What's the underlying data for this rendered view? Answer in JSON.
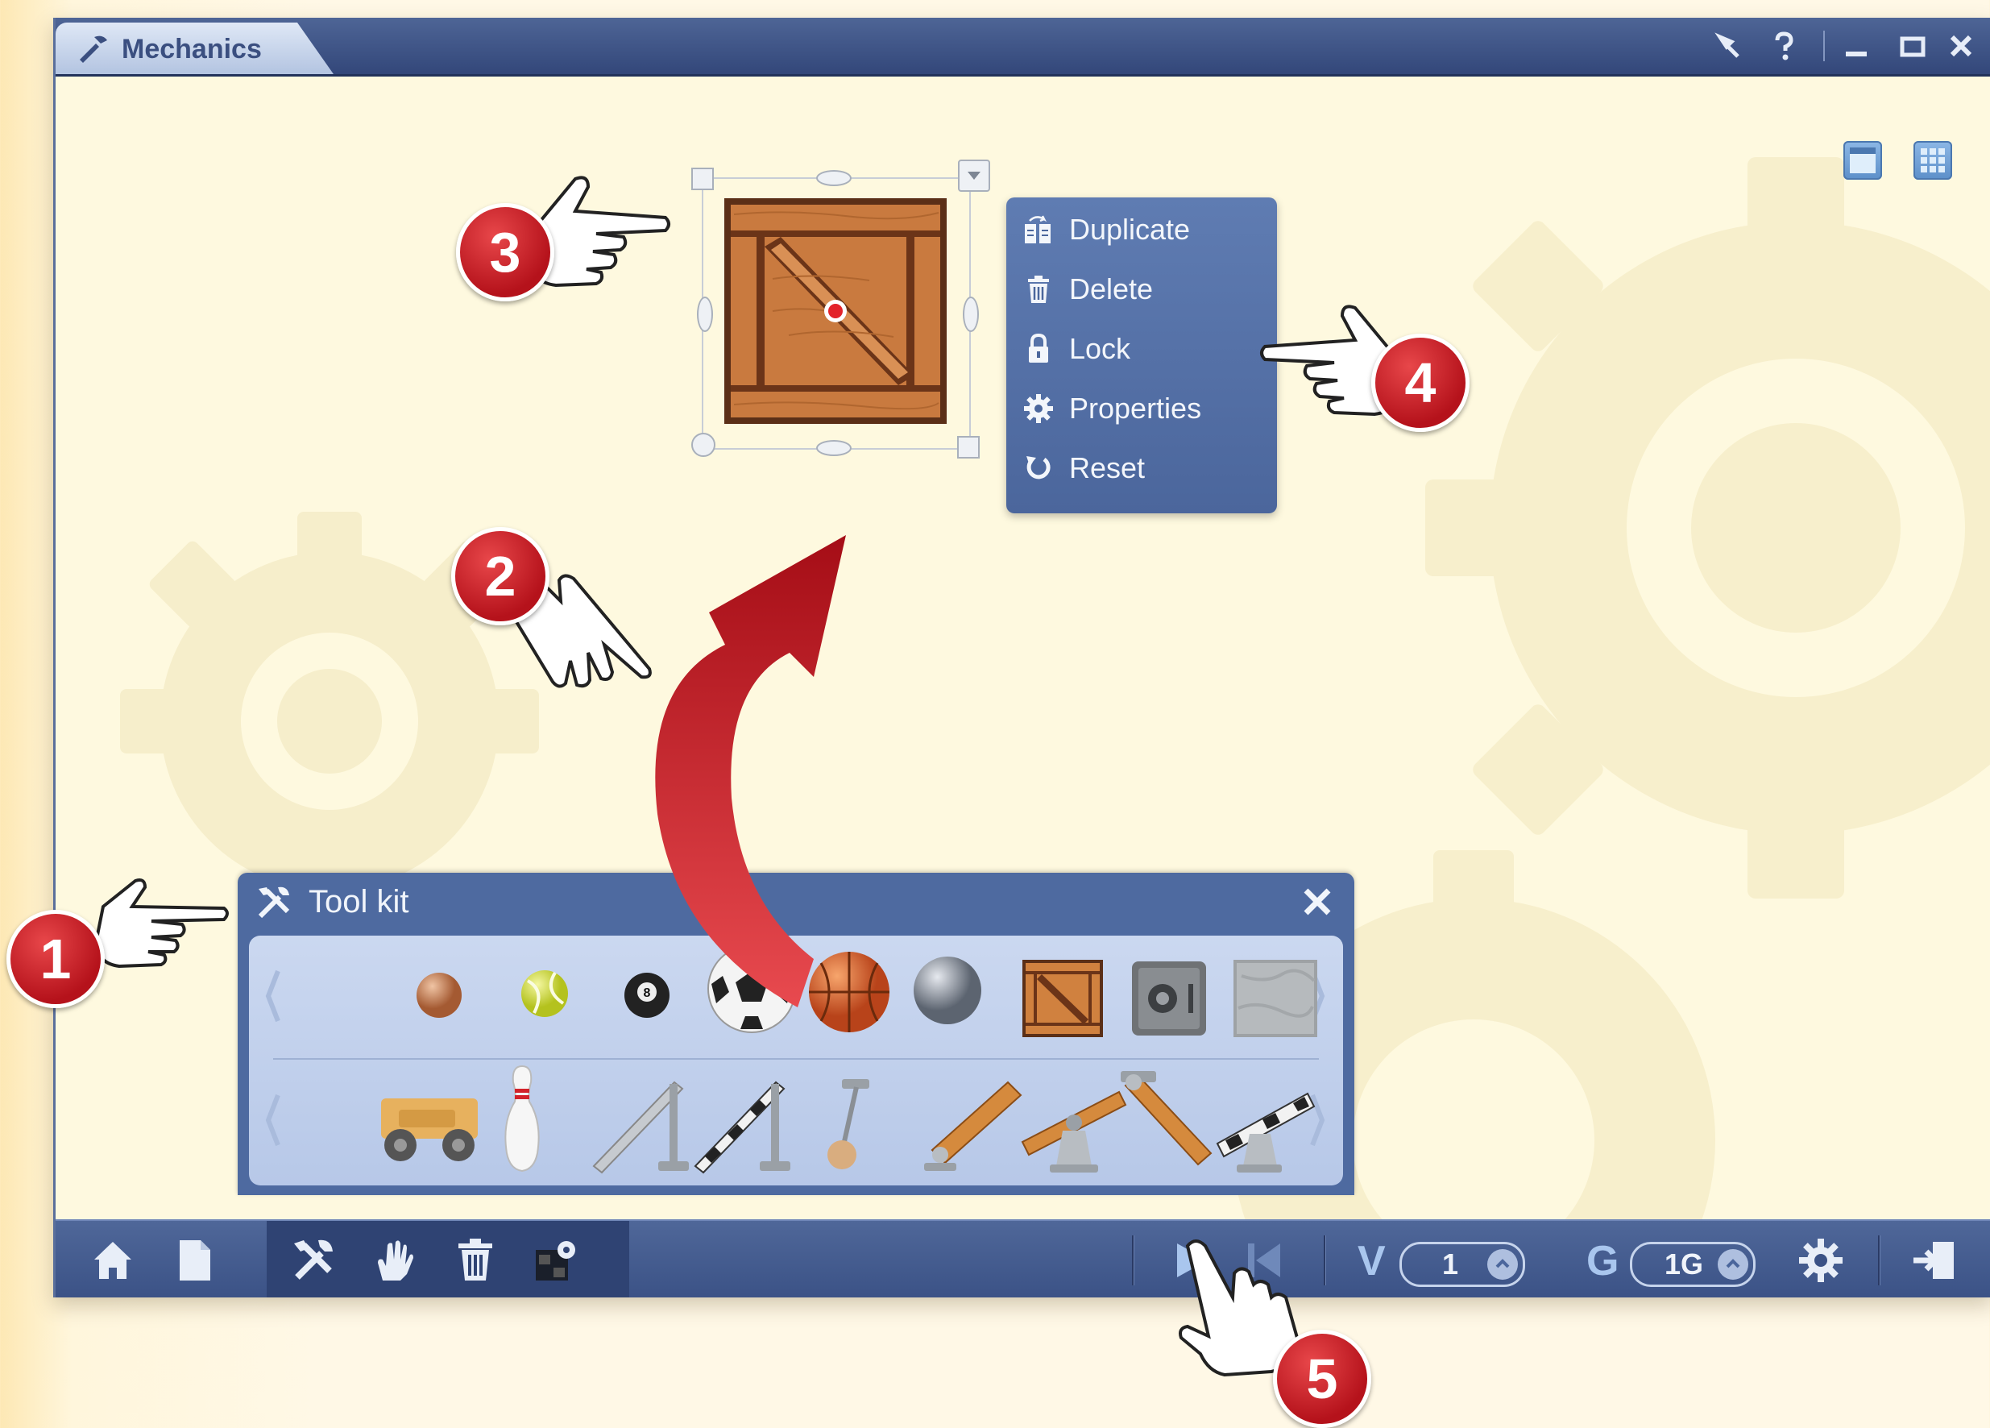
{
  "window": {
    "title": "Mechanics",
    "controls": [
      "pin-icon",
      "help-icon",
      "minimize-icon",
      "maximize-icon",
      "close-icon"
    ]
  },
  "view_buttons": [
    "single-view-icon",
    "grid-view-icon"
  ],
  "context_menu": {
    "items": [
      {
        "label": "Duplicate",
        "icon": "duplicate-icon"
      },
      {
        "label": "Delete",
        "icon": "trash-icon"
      },
      {
        "label": "Lock",
        "icon": "lock-icon"
      },
      {
        "label": "Properties",
        "icon": "gear-icon"
      },
      {
        "label": "Reset",
        "icon": "reset-icon"
      }
    ]
  },
  "toolkit": {
    "title": "Tool kit",
    "row1": [
      "wooden-ball",
      "tennis-ball",
      "billiard-ball",
      "soccer-ball",
      "basketball",
      "steel-ball",
      "wooden-crate",
      "safe",
      "stone-block"
    ],
    "row2": [
      "wooden-cart",
      "bowling-pin",
      "ramp",
      "striped-ramp",
      "pendulum",
      "plank",
      "seesaw",
      "hinged-plank",
      "striped-seesaw"
    ]
  },
  "toolbar": {
    "velocity_label": "V",
    "velocity_value": "1",
    "gravity_label": "G",
    "gravity_value": "1G"
  },
  "callouts": [
    "1",
    "2",
    "3",
    "4",
    "5"
  ],
  "colors": {
    "titlebar": "#3d5286",
    "canvas": "#fef9df",
    "badge": "#c81e24",
    "arrow": "#c8101a"
  }
}
